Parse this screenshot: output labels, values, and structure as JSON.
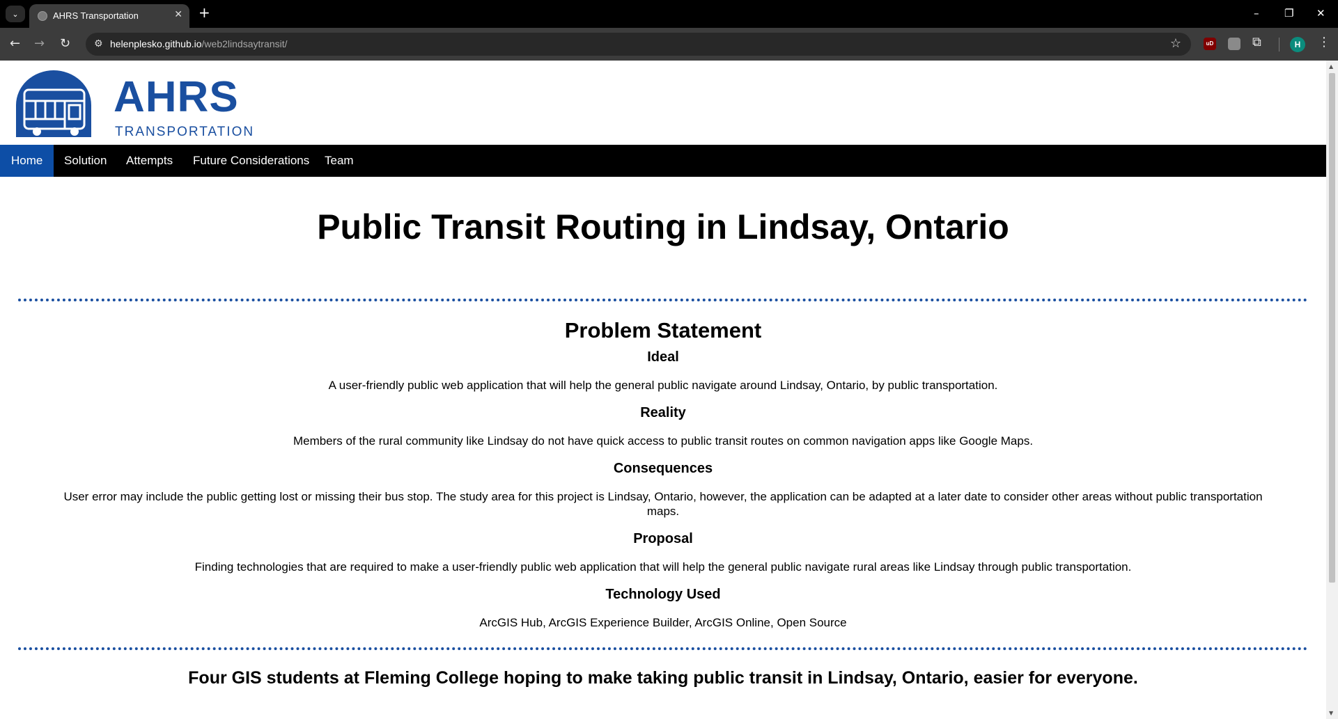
{
  "browser": {
    "tab_title": "AHRS Transportation",
    "url_domain": "helenplesko.github.io",
    "url_path": "/web2lindsaytransit/",
    "avatar_letter": "H",
    "extension_label": "uD"
  },
  "logo": {
    "title": "AHRS",
    "subtitle": "TRANSPORTATION",
    "brand_color": "#1a4fa0"
  },
  "nav": {
    "items": [
      "Home",
      "Solution",
      "Attempts",
      "Future Considerations",
      "Team"
    ],
    "active": "Home"
  },
  "hero": {
    "title": "Public Transit Routing in Lindsay, Ontario"
  },
  "problem": {
    "title": "Problem Statement",
    "sections": [
      {
        "heading": "Ideal",
        "text": "A user-friendly public web application that will help the general public navigate around Lindsay, Ontario, by public transportation."
      },
      {
        "heading": "Reality",
        "text": "Members of the rural community like Lindsay do not have quick access to public transit routes on common navigation apps like Google Maps."
      },
      {
        "heading": "Consequences",
        "text": "User error may include the public getting lost or missing their bus stop. The study area for this project is Lindsay, Ontario, however, the application can be adapted at a later date to consider other areas without public transportation maps."
      },
      {
        "heading": "Proposal",
        "text": "Finding technologies that are required to make a user-friendly public web application that will help the general public navigate rural areas like Lindsay through public transportation."
      },
      {
        "heading": "Technology Used",
        "text": "ArcGIS Hub, ArcGIS Experience Builder, ArcGIS Online, Open Source"
      }
    ]
  },
  "tagline": "Four GIS students at Fleming College hoping to make taking public transit in Lindsay, Ontario, easier for everyone."
}
